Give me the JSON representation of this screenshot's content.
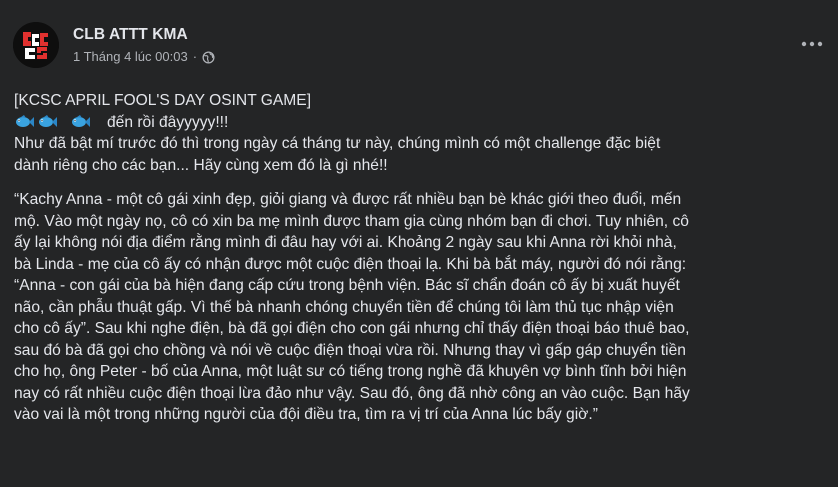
{
  "header": {
    "page_name": "CLB ATTT KMA",
    "timestamp": "1 Tháng 4 lúc 00:03",
    "separator": "·",
    "privacy_icon": "globe-icon",
    "logo_text": "KCSC",
    "more_icon": "more-horizontal-icon"
  },
  "post": {
    "title_line": "[KCSC APRIL FOOL'S DAY OSINT GAME]",
    "emoji_icons": [
      "fish-icon",
      "fish-icon",
      "fish-icon"
    ],
    "emoji_line_text": "đến rồi đâyyyyy!!!",
    "intro_line_1": "Như đã bật mí trước đó thì trong ngày cá tháng tư này,  chúng mình có một challenge đặc biệt",
    "intro_line_2": "dành riêng cho các bạn... Hãy cùng xem đó là gì nhé!!",
    "story_lines": [
      "“Kachy Anna - một cô gái xinh đẹp, giỏi giang và được rất nhiều bạn bè khác giới theo đuổi, mến",
      "mộ. Vào một ngày nọ, cô có xin ba mẹ mình được tham gia cùng nhóm bạn đi chơi. Tuy nhiên, cô",
      "ấy lại không nói địa điểm rằng mình đi đâu hay với ai. Khoảng 2 ngày sau khi Anna rời khỏi nhà,",
      "bà Linda - mẹ của cô ấy có nhận được một cuộc điện thoại lạ. Khi bà bắt máy, người đó nói rằng:",
      "“Anna - con gái của bà hiện đang cấp cứu trong bệnh viện. Bác sĩ chẩn đoán cô ấy bị xuất huyết",
      "não, cần phẫu thuật gấp. Vì thế bà nhanh chóng chuyển tiền để chúng tôi làm thủ tục nhập viện",
      "cho cô ấy”. Sau khi nghe điện, bà đã gọi điện cho con gái nhưng chỉ thấy điện thoại báo thuê bao,",
      "sau đó bà đã gọi cho chồng và nói về cuộc điện thoại vừa rồi. Nhưng thay vì gấp gáp chuyển tiền",
      "cho họ, ông Peter - bố của Anna, một luật sư có tiếng trong nghề đã khuyên vợ bình tĩnh bởi hiện",
      "nay có rất nhiều cuộc điện thoại lừa đảo như vậy. Sau đó, ông đã nhờ công an vào cuộc. Bạn hãy",
      "vào vai là một trong những người của đội điều tra, tìm ra vị trí của Anna lúc bấy giờ.”"
    ]
  },
  "colors": {
    "background": "#242526",
    "primary_text": "#e4e6eb",
    "secondary_text": "#b0b3b8",
    "logo_red": "#e1312f"
  }
}
